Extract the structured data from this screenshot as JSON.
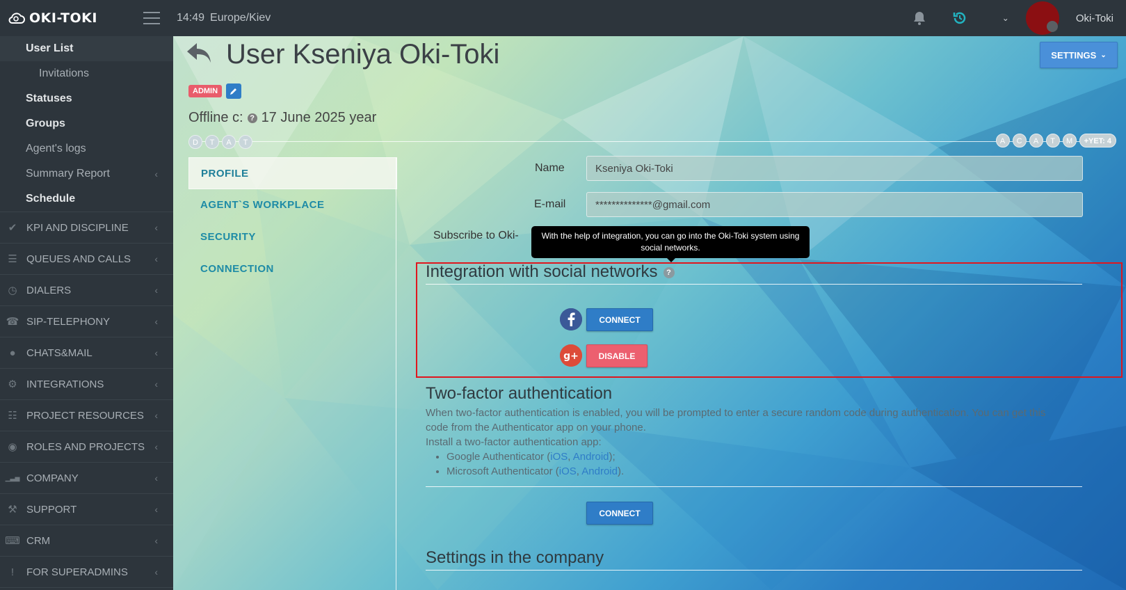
{
  "app": {
    "logo": "OKI-TOKI",
    "time": "14:49",
    "timezone": "Europe/Kiev",
    "username": "Oki-Toki"
  },
  "sidebar": {
    "sub_items": [
      {
        "label": "User List",
        "style": "active"
      },
      {
        "label": "Invitations",
        "style": "indent"
      },
      {
        "label": "Statuses",
        "style": "bold"
      },
      {
        "label": "Groups",
        "style": "bold"
      },
      {
        "label": "Agent's logs",
        "style": "normal"
      },
      {
        "label": "Summary Report",
        "style": "normal"
      },
      {
        "label": "Schedule",
        "style": "bold"
      }
    ],
    "menu": [
      {
        "label": "KPI AND DISCIPLINE",
        "icon": "check-icon"
      },
      {
        "label": "QUEUES AND CALLS",
        "icon": "list-icon"
      },
      {
        "label": "DIALERS",
        "icon": "clock-icon"
      },
      {
        "label": "SIP-TELEPHONY",
        "icon": "phone-icon"
      },
      {
        "label": "CHATS&MAIL",
        "icon": "chat-icon"
      },
      {
        "label": "INTEGRATIONS",
        "icon": "gears-icon"
      },
      {
        "label": "PROJECT RESOURCES",
        "icon": "grid-icon"
      },
      {
        "label": "ROLES AND PROJECTS",
        "icon": "toggle-icon"
      },
      {
        "label": "COMPANY",
        "icon": "bar-chart-icon"
      },
      {
        "label": "SUPPORT",
        "icon": "wrench-icon"
      },
      {
        "label": "CRM",
        "icon": "keyboard-icon"
      },
      {
        "label": "FOR SUPERADMINS",
        "icon": "exclamation-icon"
      }
    ]
  },
  "page": {
    "title": "User Kseniya Oki-Toki",
    "badge": "ADMIN",
    "offline_label": "Offline c:",
    "offline_date": "17 June 2025 year",
    "left_circles": [
      "D",
      "T",
      "A",
      "T"
    ],
    "right_circles": [
      "A",
      "C",
      "A",
      "T",
      "M"
    ],
    "more_label": "+YET: 4",
    "settings_label": "SETTINGS"
  },
  "tabs": [
    "PROFILE",
    "AGENT`S WORKPLACE",
    "SECURITY",
    "CONNECTION"
  ],
  "form": {
    "name_label": "Name",
    "name_value": "Kseniya Oki-Toki",
    "email_label": "E-mail",
    "email_value": "**************@gmail.com",
    "subscribe_label": "Subscribe to Oki-"
  },
  "tooltip": "With the help of integration, you can go into the Oki-Toki system using social networks.",
  "social": {
    "title": "Integration with social networks",
    "facebook_btn": "CONNECT",
    "google_btn": "DISABLE"
  },
  "twofa": {
    "title": "Two-factor authentication",
    "line1": "When two-factor authentication is enabled, you will be prompted to enter a secure random code during authentication. You can get this",
    "line2": "code from the Authenticator app on your phone.",
    "line3": "Install a two-factor authentication app:",
    "google_name": "Google Authenticator (",
    "google_ios": "iOS",
    "google_sep": ", ",
    "google_android": "Android",
    "google_end": ");",
    "ms_name": "Microsoft Authenticator (",
    "ms_ios": "iOS",
    "ms_sep": ", ",
    "ms_android": "Android",
    "ms_end": ").",
    "connect_btn": "CONNECT"
  },
  "company_settings_title": "Settings in the company"
}
